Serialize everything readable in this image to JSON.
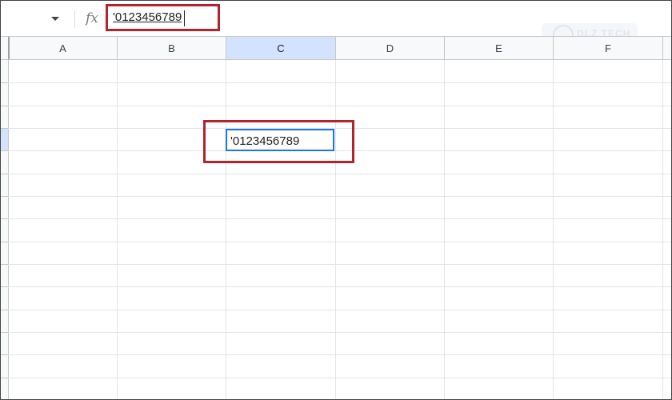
{
  "formula_bar": {
    "fx_label": "fx",
    "value": "'0123456789"
  },
  "watermark": {
    "text": "DLZ TECH"
  },
  "columns": [
    "A",
    "B",
    "C",
    "D",
    "E",
    "F"
  ],
  "selected_column": "C",
  "active_cell": {
    "column": "C",
    "value": "'0123456789"
  },
  "colors": {
    "highlight_box": "#b2232d",
    "selection_border": "#1a73e8",
    "selected_header": "#d3e3fd"
  },
  "icons": {
    "namebox_dropdown": "chevron-down-icon",
    "function": "fx-icon"
  }
}
